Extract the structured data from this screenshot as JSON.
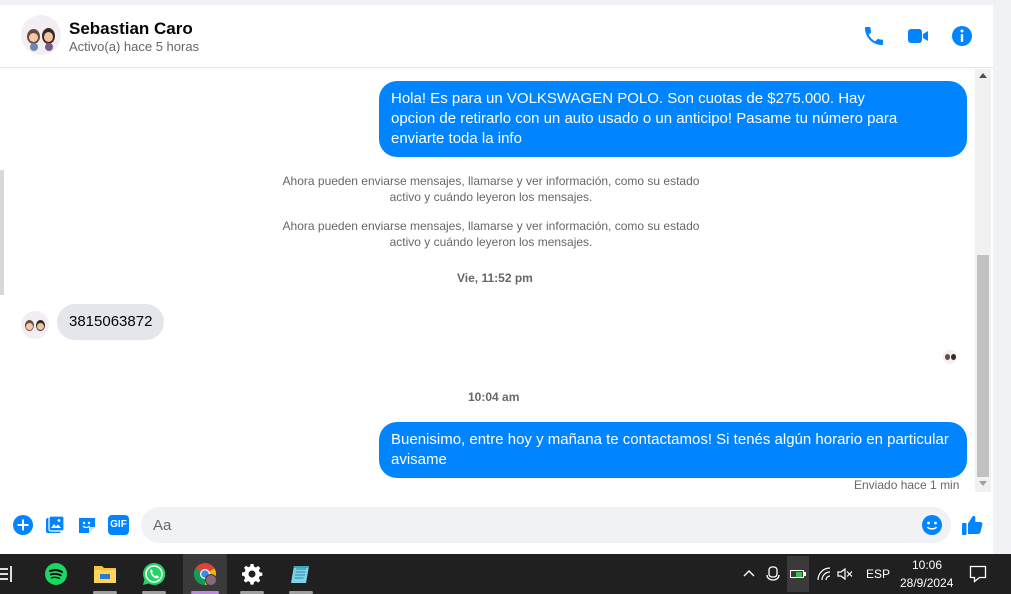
{
  "header": {
    "contact_name": "Sebastian Caro",
    "status": "Activo(a) hace 5 horas",
    "call_icon": "phone-icon",
    "video_icon": "video-camera-icon",
    "info_icon": "info-icon"
  },
  "messages": {
    "outgoing_1": "Hola! Es para un VOLKSWAGEN POLO. Son cuotas de $275.000. Hay opcion de retirarlo con un auto usado o un anticipo! Pasame tu número para enviarte toda la info",
    "system_1": "Ahora pueden enviarse mensajes, llamarse y ver información, como su estado activo y cuándo leyeron los mensajes.",
    "system_2": "Ahora pueden enviarse mensajes, llamarse y ver información, como su estado activo y cuándo leyeron los mensajes.",
    "time_1": "Vie, 11:52 pm",
    "incoming_1": "3815063872",
    "time_2": "10:04 am",
    "outgoing_2": "Buenisimo, entre hoy y mañana te contactamos! Si tenés algún horario en particular avisame",
    "sent_status": "Enviado hace 1 min"
  },
  "composer": {
    "placeholder": "Aa",
    "icons": [
      "plus-icon",
      "image-icon",
      "sticker-icon",
      "gif-icon",
      "emoji-icon",
      "thumbs-up-icon"
    ],
    "gif_label": "GIF"
  },
  "taskbar": {
    "apps": [
      "spotify-icon",
      "file-explorer-icon",
      "whatsapp-icon",
      "chrome-icon",
      "settings-icon",
      "notepad-icon"
    ],
    "language": "ESP",
    "time": "10:06",
    "date": "28/9/2024"
  },
  "colors": {
    "accent": "#0084ff",
    "bubble_in": "#e4e6eb",
    "taskbar": "#202020"
  }
}
